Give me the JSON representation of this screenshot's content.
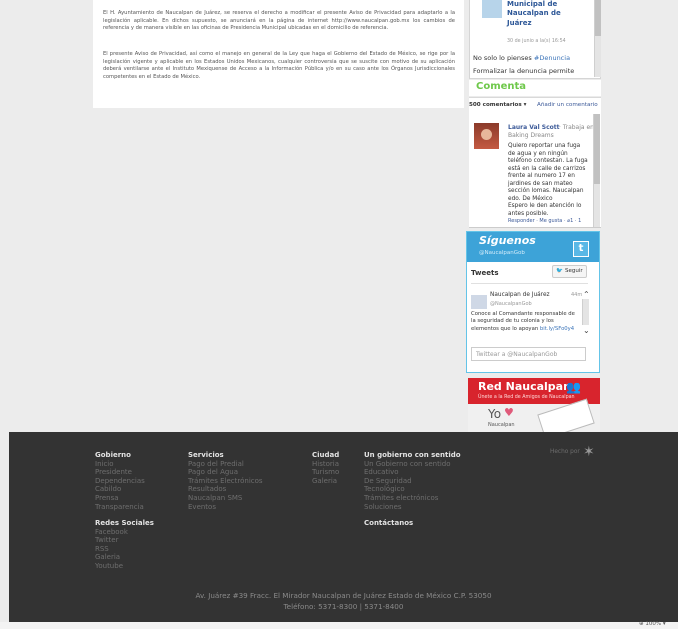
{
  "policy": {
    "p1": "El H. Ayuntamiento de Naucalpan de Juárez, se reserva el derecho a modificar el presente Aviso de Privacidad para adaptarlo a la legislación aplicable. En dichos supuesto, se anunciará en la página de internet http://www.naucalpan.gob.mx los cambios de referencia y de manera visible en las oficinas de Presidencia Municipal ubicadas en el domicilio de referencia.",
    "p2": "El presente Aviso de Privacidad, así como el manejo en general de la Ley que haga el Gobierno del Estado de México, se rige por la legislación vigente y aplicable en los Estados Unidos Mexicanos, cualquier controversia que se suscite con motivo de su aplicación deberá ventilarse ante el Instituto Mexiquense de Acceso a la Información Pública y/o en su caso ante los Órganos Jurisdiccionales competentes en el Estado de México."
  },
  "feed": {
    "title": "Municipal de Naucalpan de Juárez",
    "date": "30 de junio a la(s) 16:54",
    "text1": "No solo lo pienses",
    "text1_tag": "#Denuncia",
    "text2": "Formalizar la denuncia permite"
  },
  "comments": {
    "heading": "Comenta",
    "count_label": "500 comentarios ▾",
    "add_label": "Añadir un comentario",
    "author": "Laura Val Scott",
    "author_meta": "· Trabaja en",
    "author_work": "Baking Dreams",
    "body": "Quiero reportar una fuga\nde agua y en ningún\nteléfono contestan. La fuga\nestá en la calle de carrizos\nfrente al numero 17 en\njardines de san mateo\nsección lomas. Naucalpan\nedo. De México\nEspero le den atención lo\nantes posible.",
    "actions": "Responder · Me gusta · ⌀1 · 1"
  },
  "twitter": {
    "siguenos": "Síguenos",
    "handle_header": "@NaucalpanGob",
    "bird_icon": "t",
    "tweets_label": "Tweets",
    "follow_label": "Seguir",
    "tweet_name": "Naucalpan de Juárez",
    "tweet_handle": "@NaucalpanGob",
    "tweet_time": "44m",
    "tweet_text": "Conoce al Comandante responsable de la seguridad de tu colonia y los elementos que lo apoyan",
    "tweet_link": "bit.ly/SFo0y4",
    "compose_placeholder": "Twittear a @NaucalpanGob"
  },
  "red": {
    "title": "Red Naucalpan",
    "subtitle": "Únete a la Red de Amigos de Naucalpan",
    "yo": "Yo",
    "naucalpan": "Naucalpan"
  },
  "footer": {
    "col1_title": "Gobierno",
    "col1_items": [
      "Inicio",
      "Presidente",
      "Dependencias",
      "Cabildo",
      "Prensa",
      "Transparencia"
    ],
    "col1b_title": "Redes Sociales",
    "col1b_items": [
      "Facebook",
      "Twitter",
      "RSS",
      "Galeria",
      "Youtube"
    ],
    "col2_title": "Servicios",
    "col2_items": [
      "Pago del Predial",
      "Pago del Agua",
      "Trámites Electrónicos",
      "Resultados",
      "Naucalpan SMS",
      "Eventos"
    ],
    "col3_title": "Ciudad",
    "col3_items": [
      "Historia",
      "Turismo",
      "Galeria"
    ],
    "col4_title": "Un gobierno con sentido",
    "col4_items": [
      "Un Gobierno con sentido",
      "Educativo",
      "De Seguridad",
      "Tecnológico",
      "Trámites electrónicos",
      "Soluciones"
    ],
    "col4b_title": "Contáctanos",
    "hecho": "Hecho por",
    "address": "Av. Juárez #39 Fracc. El Mirador Naucalpan de Juárez Estado de México C.P. 53050",
    "phone": "Teléfono:  5371-8300  |  5371-8400"
  },
  "statusbar": {
    "zoom": "⊕ 100% ▾"
  }
}
